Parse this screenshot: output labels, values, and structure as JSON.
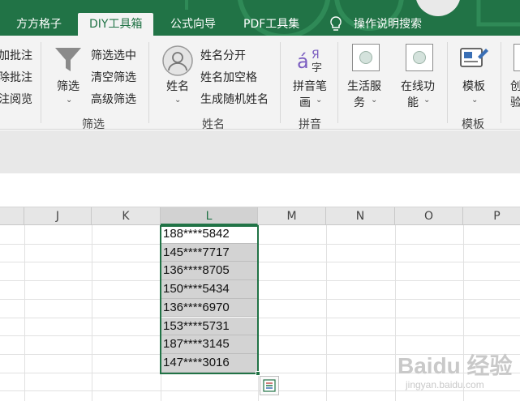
{
  "tabs": [
    {
      "label": "方方格子",
      "active": false
    },
    {
      "label": "DIY工具箱",
      "active": true
    },
    {
      "label": "公式向导",
      "active": false
    },
    {
      "label": "PDF工具集",
      "active": false
    },
    {
      "label": "操作说明搜索",
      "active": false
    }
  ],
  "ribbon": {
    "comments": {
      "items": [
        "加批注",
        "除批注",
        "注阅览"
      ]
    },
    "filter": {
      "big_label": "筛选",
      "items": [
        "筛选选中",
        "清空筛选",
        "高级筛选"
      ],
      "group_label": "筛选"
    },
    "name": {
      "big_label": "姓名",
      "items": [
        "姓名分开",
        "姓名加空格",
        "生成随机姓名"
      ],
      "group_label": "姓名"
    },
    "pinyin": {
      "big_label_1": "拼音笔",
      "big_label_2": "画",
      "group_label": "拼音"
    },
    "life": {
      "label_1": "生活服",
      "label_2": "务"
    },
    "online": {
      "label_1": "在线功",
      "label_2": "能"
    },
    "template": {
      "big_label": "模板",
      "group_label": "模板"
    },
    "cut_off": {
      "line1": "创",
      "line2": "验"
    }
  },
  "sheet": {
    "columns": [
      "J",
      "K",
      "L",
      "M",
      "N",
      "O",
      "P"
    ],
    "selected_column": "L",
    "cells": [
      "188****5842",
      "145****7717",
      "136****8705",
      "150****5434",
      "136****6970",
      "153****5731",
      "187****3145",
      "147****3016"
    ]
  },
  "watermark": {
    "line1": "Baidu 经验",
    "line2": "jingyan.baidu.com"
  },
  "colors": {
    "accent": "#217346",
    "selection_fill": "#d3d3d3"
  }
}
